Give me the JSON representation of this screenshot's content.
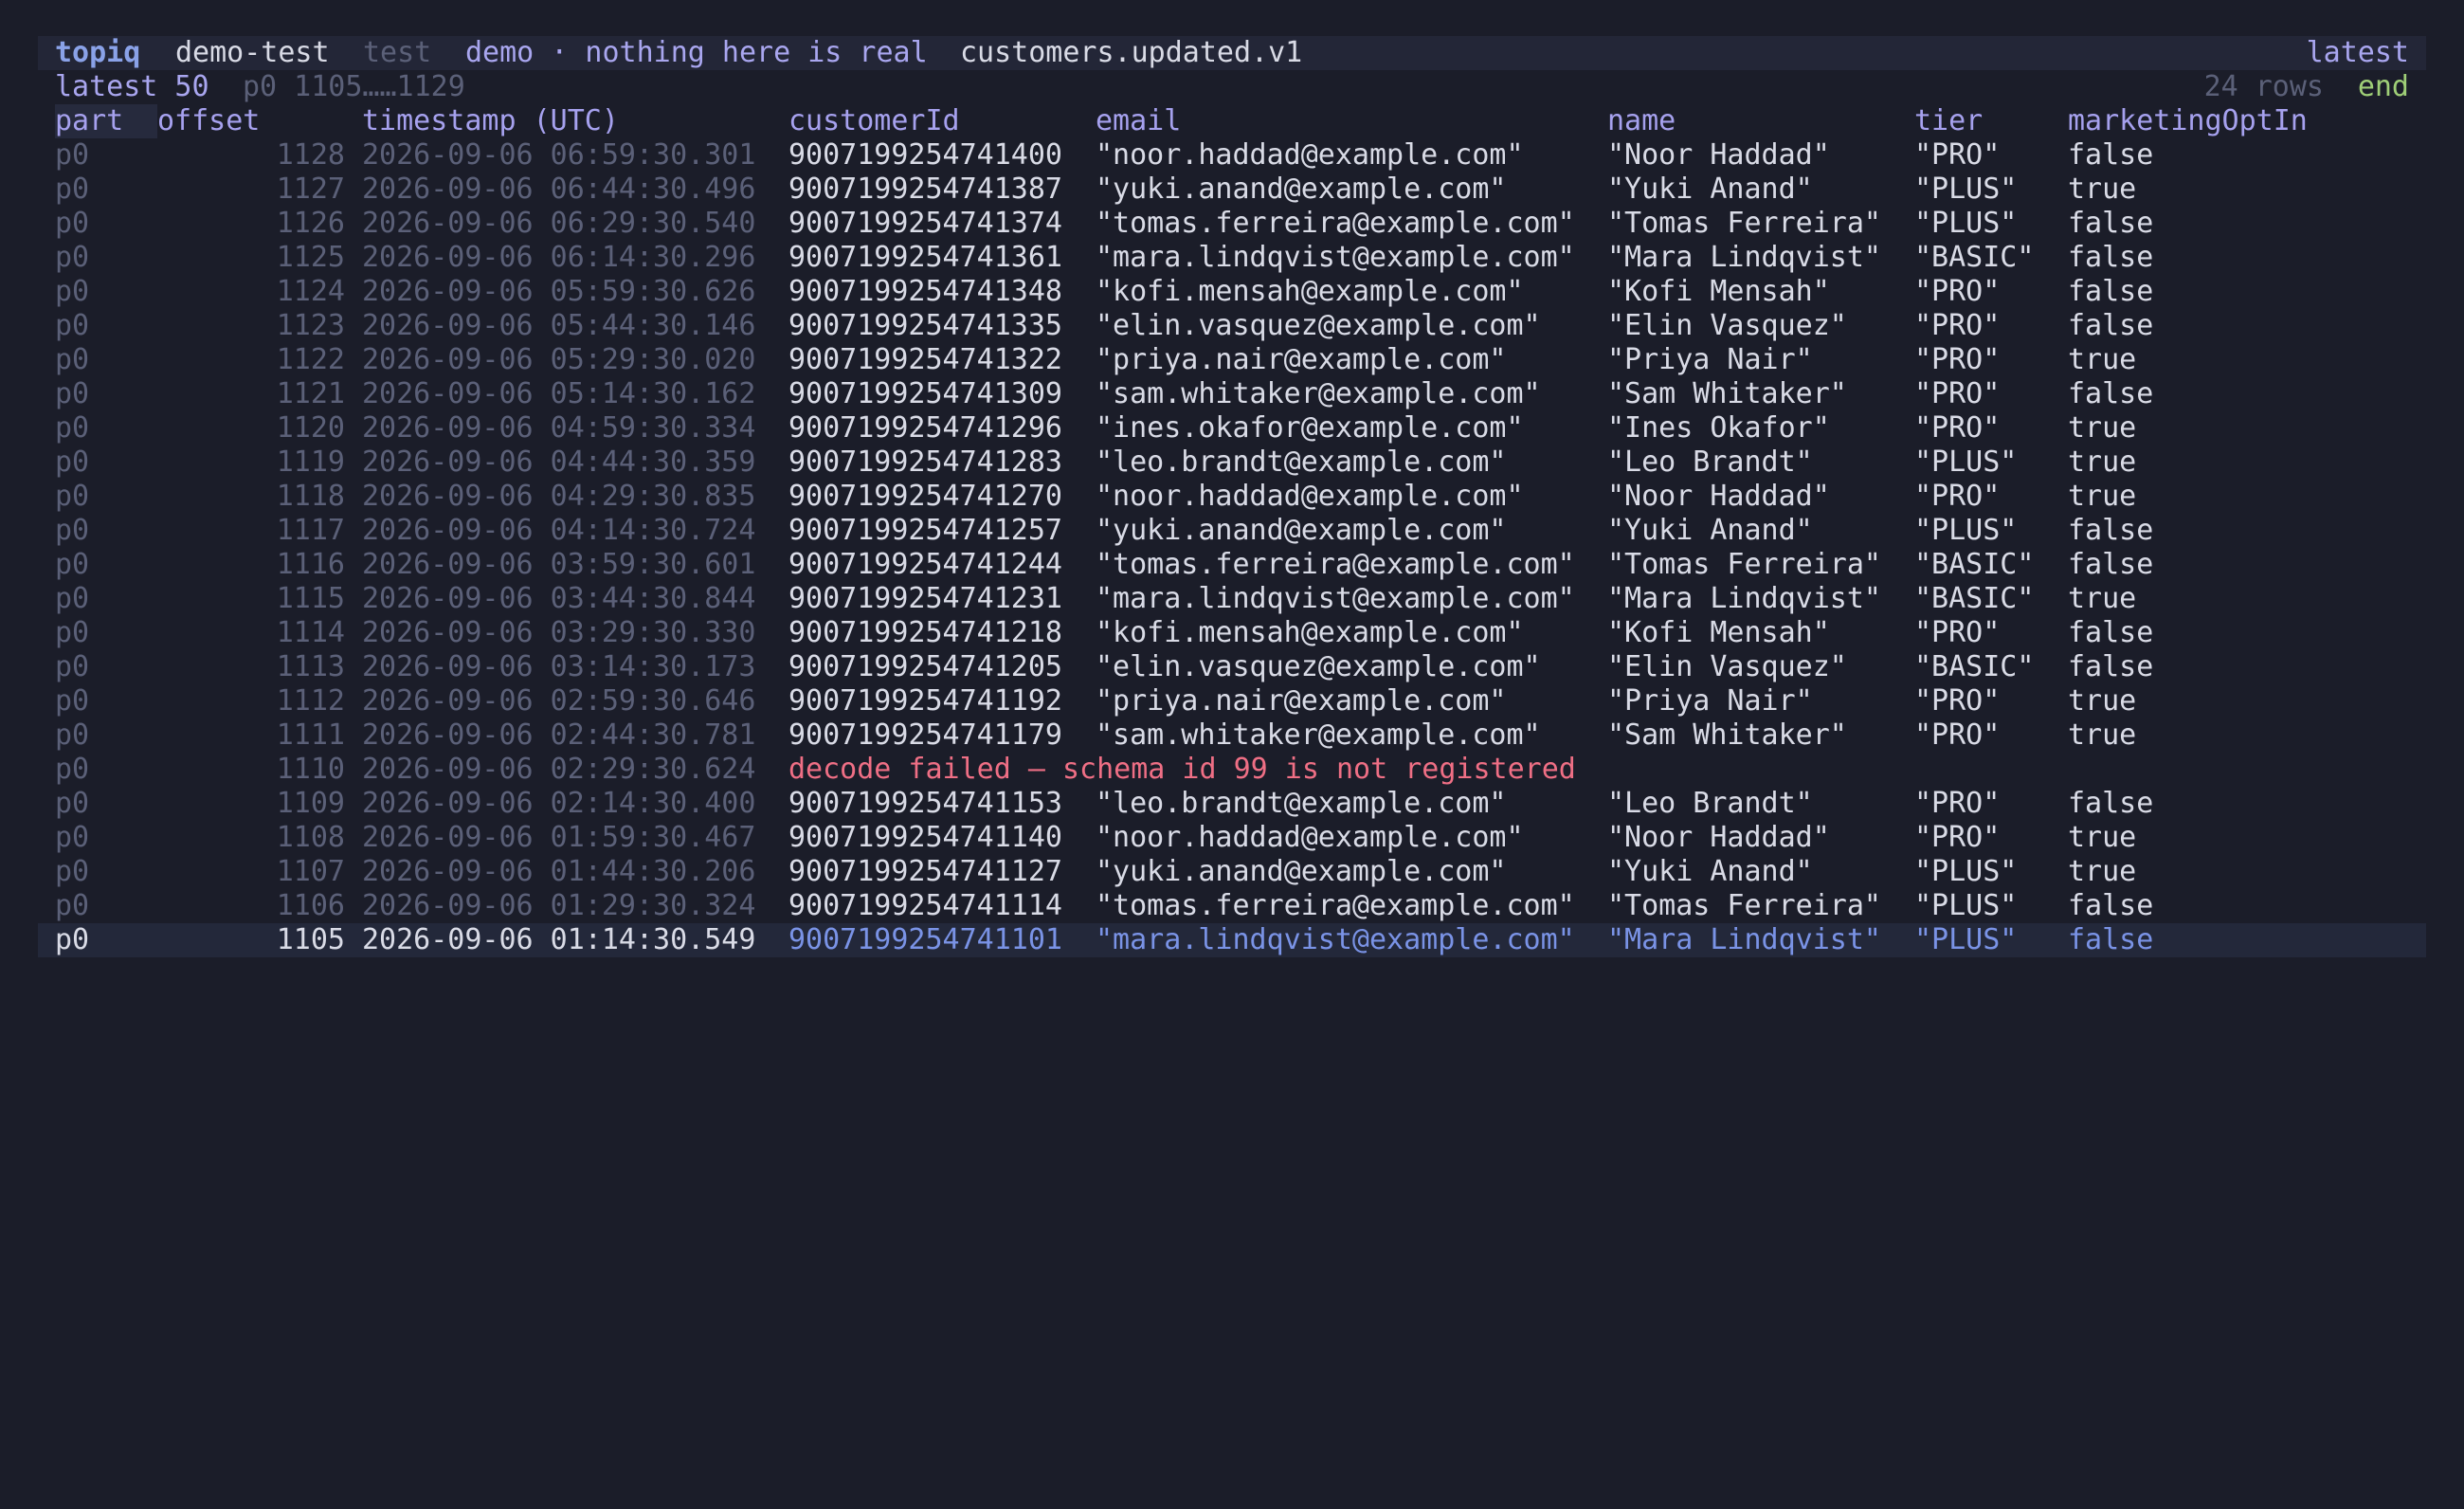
{
  "titlebar": {
    "app": "topiq",
    "cluster": "demo-test",
    "env": "test",
    "banner": "demo · nothing here is real",
    "topic": "customers.updated.v1",
    "mode": "latest"
  },
  "statusbar": {
    "window": "latest 50",
    "range": "p0 1105……1129",
    "rows": "24 rows",
    "position": "end"
  },
  "table": {
    "columns": [
      "part",
      "offset",
      "timestamp (UTC)",
      "customerId",
      "email",
      "name",
      "tier",
      "marketingOptIn"
    ],
    "rows": [
      {
        "part": "p0",
        "offset": "1128",
        "ts": "2026-09-06 06:59:30.301",
        "id": "9007199254741400",
        "email": "\"noor.haddad@example.com\"",
        "name": "\"Noor Haddad\"",
        "tier": "\"PRO\"",
        "opt": "false"
      },
      {
        "part": "p0",
        "offset": "1127",
        "ts": "2026-09-06 06:44:30.496",
        "id": "9007199254741387",
        "email": "\"yuki.anand@example.com\"",
        "name": "\"Yuki Anand\"",
        "tier": "\"PLUS\"",
        "opt": "true"
      },
      {
        "part": "p0",
        "offset": "1126",
        "ts": "2026-09-06 06:29:30.540",
        "id": "9007199254741374",
        "email": "\"tomas.ferreira@example.com\"",
        "name": "\"Tomas Ferreira\"",
        "tier": "\"PLUS\"",
        "opt": "false"
      },
      {
        "part": "p0",
        "offset": "1125",
        "ts": "2026-09-06 06:14:30.296",
        "id": "9007199254741361",
        "email": "\"mara.lindqvist@example.com\"",
        "name": "\"Mara Lindqvist\"",
        "tier": "\"BASIC\"",
        "opt": "false"
      },
      {
        "part": "p0",
        "offset": "1124",
        "ts": "2026-09-06 05:59:30.626",
        "id": "9007199254741348",
        "email": "\"kofi.mensah@example.com\"",
        "name": "\"Kofi Mensah\"",
        "tier": "\"PRO\"",
        "opt": "false"
      },
      {
        "part": "p0",
        "offset": "1123",
        "ts": "2026-09-06 05:44:30.146",
        "id": "9007199254741335",
        "email": "\"elin.vasquez@example.com\"",
        "name": "\"Elin Vasquez\"",
        "tier": "\"PRO\"",
        "opt": "false"
      },
      {
        "part": "p0",
        "offset": "1122",
        "ts": "2026-09-06 05:29:30.020",
        "id": "9007199254741322",
        "email": "\"priya.nair@example.com\"",
        "name": "\"Priya Nair\"",
        "tier": "\"PRO\"",
        "opt": "true"
      },
      {
        "part": "p0",
        "offset": "1121",
        "ts": "2026-09-06 05:14:30.162",
        "id": "9007199254741309",
        "email": "\"sam.whitaker@example.com\"",
        "name": "\"Sam Whitaker\"",
        "tier": "\"PRO\"",
        "opt": "false"
      },
      {
        "part": "p0",
        "offset": "1120",
        "ts": "2026-09-06 04:59:30.334",
        "id": "9007199254741296",
        "email": "\"ines.okafor@example.com\"",
        "name": "\"Ines Okafor\"",
        "tier": "\"PRO\"",
        "opt": "true"
      },
      {
        "part": "p0",
        "offset": "1119",
        "ts": "2026-09-06 04:44:30.359",
        "id": "9007199254741283",
        "email": "\"leo.brandt@example.com\"",
        "name": "\"Leo Brandt\"",
        "tier": "\"PLUS\"",
        "opt": "true"
      },
      {
        "part": "p0",
        "offset": "1118",
        "ts": "2026-09-06 04:29:30.835",
        "id": "9007199254741270",
        "email": "\"noor.haddad@example.com\"",
        "name": "\"Noor Haddad\"",
        "tier": "\"PRO\"",
        "opt": "true"
      },
      {
        "part": "p0",
        "offset": "1117",
        "ts": "2026-09-06 04:14:30.724",
        "id": "9007199254741257",
        "email": "\"yuki.anand@example.com\"",
        "name": "\"Yuki Anand\"",
        "tier": "\"PLUS\"",
        "opt": "false"
      },
      {
        "part": "p0",
        "offset": "1116",
        "ts": "2026-09-06 03:59:30.601",
        "id": "9007199254741244",
        "email": "\"tomas.ferreira@example.com\"",
        "name": "\"Tomas Ferreira\"",
        "tier": "\"BASIC\"",
        "opt": "false"
      },
      {
        "part": "p0",
        "offset": "1115",
        "ts": "2026-09-06 03:44:30.844",
        "id": "9007199254741231",
        "email": "\"mara.lindqvist@example.com\"",
        "name": "\"Mara Lindqvist\"",
        "tier": "\"BASIC\"",
        "opt": "true"
      },
      {
        "part": "p0",
        "offset": "1114",
        "ts": "2026-09-06 03:29:30.330",
        "id": "9007199254741218",
        "email": "\"kofi.mensah@example.com\"",
        "name": "\"Kofi Mensah\"",
        "tier": "\"PRO\"",
        "opt": "false"
      },
      {
        "part": "p0",
        "offset": "1113",
        "ts": "2026-09-06 03:14:30.173",
        "id": "9007199254741205",
        "email": "\"elin.vasquez@example.com\"",
        "name": "\"Elin Vasquez\"",
        "tier": "\"BASIC\"",
        "opt": "false"
      },
      {
        "part": "p0",
        "offset": "1112",
        "ts": "2026-09-06 02:59:30.646",
        "id": "9007199254741192",
        "email": "\"priya.nair@example.com\"",
        "name": "\"Priya Nair\"",
        "tier": "\"PRO\"",
        "opt": "true"
      },
      {
        "part": "p0",
        "offset": "1111",
        "ts": "2026-09-06 02:44:30.781",
        "id": "9007199254741179",
        "email": "\"sam.whitaker@example.com\"",
        "name": "\"Sam Whitaker\"",
        "tier": "\"PRO\"",
        "opt": "true"
      },
      {
        "part": "p0",
        "offset": "1110",
        "ts": "2026-09-06 02:29:30.624",
        "error": "decode failed — schema id 99 is not registered"
      },
      {
        "part": "p0",
        "offset": "1109",
        "ts": "2026-09-06 02:14:30.400",
        "id": "9007199254741153",
        "email": "\"leo.brandt@example.com\"",
        "name": "\"Leo Brandt\"",
        "tier": "\"PRO\"",
        "opt": "false"
      },
      {
        "part": "p0",
        "offset": "1108",
        "ts": "2026-09-06 01:59:30.467",
        "id": "9007199254741140",
        "email": "\"noor.haddad@example.com\"",
        "name": "\"Noor Haddad\"",
        "tier": "\"PRO\"",
        "opt": "true"
      },
      {
        "part": "p0",
        "offset": "1107",
        "ts": "2026-09-06 01:44:30.206",
        "id": "9007199254741127",
        "email": "\"yuki.anand@example.com\"",
        "name": "\"Yuki Anand\"",
        "tier": "\"PLUS\"",
        "opt": "true"
      },
      {
        "part": "p0",
        "offset": "1106",
        "ts": "2026-09-06 01:29:30.324",
        "id": "9007199254741114",
        "email": "\"tomas.ferreira@example.com\"",
        "name": "\"Tomas Ferreira\"",
        "tier": "\"PLUS\"",
        "opt": "false"
      },
      {
        "part": "p0",
        "offset": "1105",
        "ts": "2026-09-06 01:14:30.549",
        "id": "9007199254741101",
        "email": "\"mara.lindqvist@example.com\"",
        "name": "\"Mara Lindqvist\"",
        "tier": "\"PLUS\"",
        "opt": "false",
        "selected": true
      }
    ]
  },
  "colors": {
    "background": "#1b1d29",
    "accent": "#8aa2e8",
    "error": "#ef6f85",
    "ok": "#9fcf77"
  }
}
